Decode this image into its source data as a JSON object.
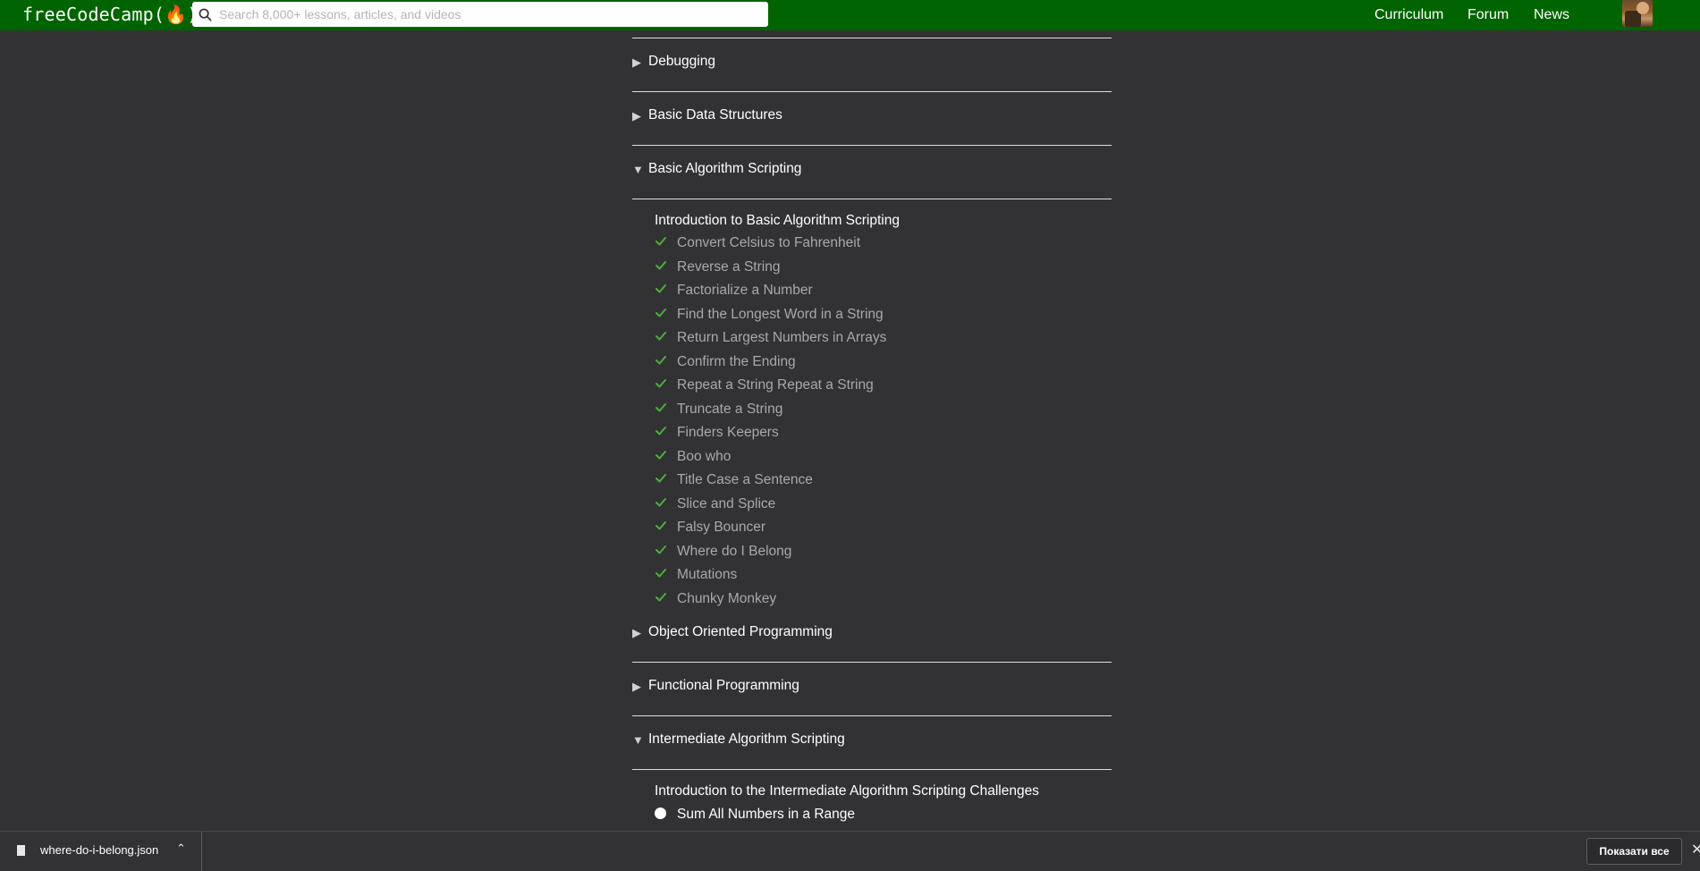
{
  "navbar": {
    "logo_text": "freeCodeCamp(",
    "logo_close": ")",
    "search_placeholder": "Search 8,000+ lessons, articles, and videos",
    "links": [
      "Curriculum",
      "Forum",
      "News"
    ]
  },
  "colors": {
    "navbar_bg": "#006400",
    "page_bg": "#323234",
    "check": "#4ead3e"
  },
  "blocks": {
    "debugging": {
      "title": "Debugging",
      "expanded": false
    },
    "basic_data_structures": {
      "title": "Basic Data Structures",
      "expanded": false
    },
    "basic_algorithm_scripting": {
      "title": "Basic Algorithm Scripting",
      "expanded": true,
      "intro": "Introduction to Basic Algorithm Scripting",
      "challenges": [
        {
          "label": "Convert Celsius to Fahrenheit",
          "completed": true
        },
        {
          "label": "Reverse a String",
          "completed": true
        },
        {
          "label": "Factorialize a Number",
          "completed": true
        },
        {
          "label": "Find the Longest Word in a String",
          "completed": true
        },
        {
          "label": "Return Largest Numbers in Arrays",
          "completed": true
        },
        {
          "label": "Confirm the Ending",
          "completed": true
        },
        {
          "label": "Repeat a String Repeat a String",
          "completed": true
        },
        {
          "label": "Truncate a String",
          "completed": true
        },
        {
          "label": "Finders Keepers",
          "completed": true
        },
        {
          "label": "Boo who",
          "completed": true
        },
        {
          "label": "Title Case a Sentence",
          "completed": true
        },
        {
          "label": "Slice and Splice",
          "completed": true
        },
        {
          "label": "Falsy Bouncer",
          "completed": true
        },
        {
          "label": "Where do I Belong",
          "completed": true
        },
        {
          "label": "Mutations",
          "completed": true
        },
        {
          "label": "Chunky Monkey",
          "completed": true
        }
      ]
    },
    "object_oriented_programming": {
      "title": "Object Oriented Programming",
      "expanded": false
    },
    "functional_programming": {
      "title": "Functional Programming",
      "expanded": false
    },
    "intermediate_algorithm_scripting": {
      "title": "Intermediate Algorithm Scripting",
      "expanded": true,
      "intro": "Introduction to the Intermediate Algorithm Scripting Challenges",
      "challenges": [
        {
          "label": "Sum All Numbers in a Range",
          "completed": false
        }
      ]
    }
  },
  "download_bar": {
    "file_name": "where-do-i-belong.json",
    "show_all": "Показати все",
    "close": "✕"
  }
}
